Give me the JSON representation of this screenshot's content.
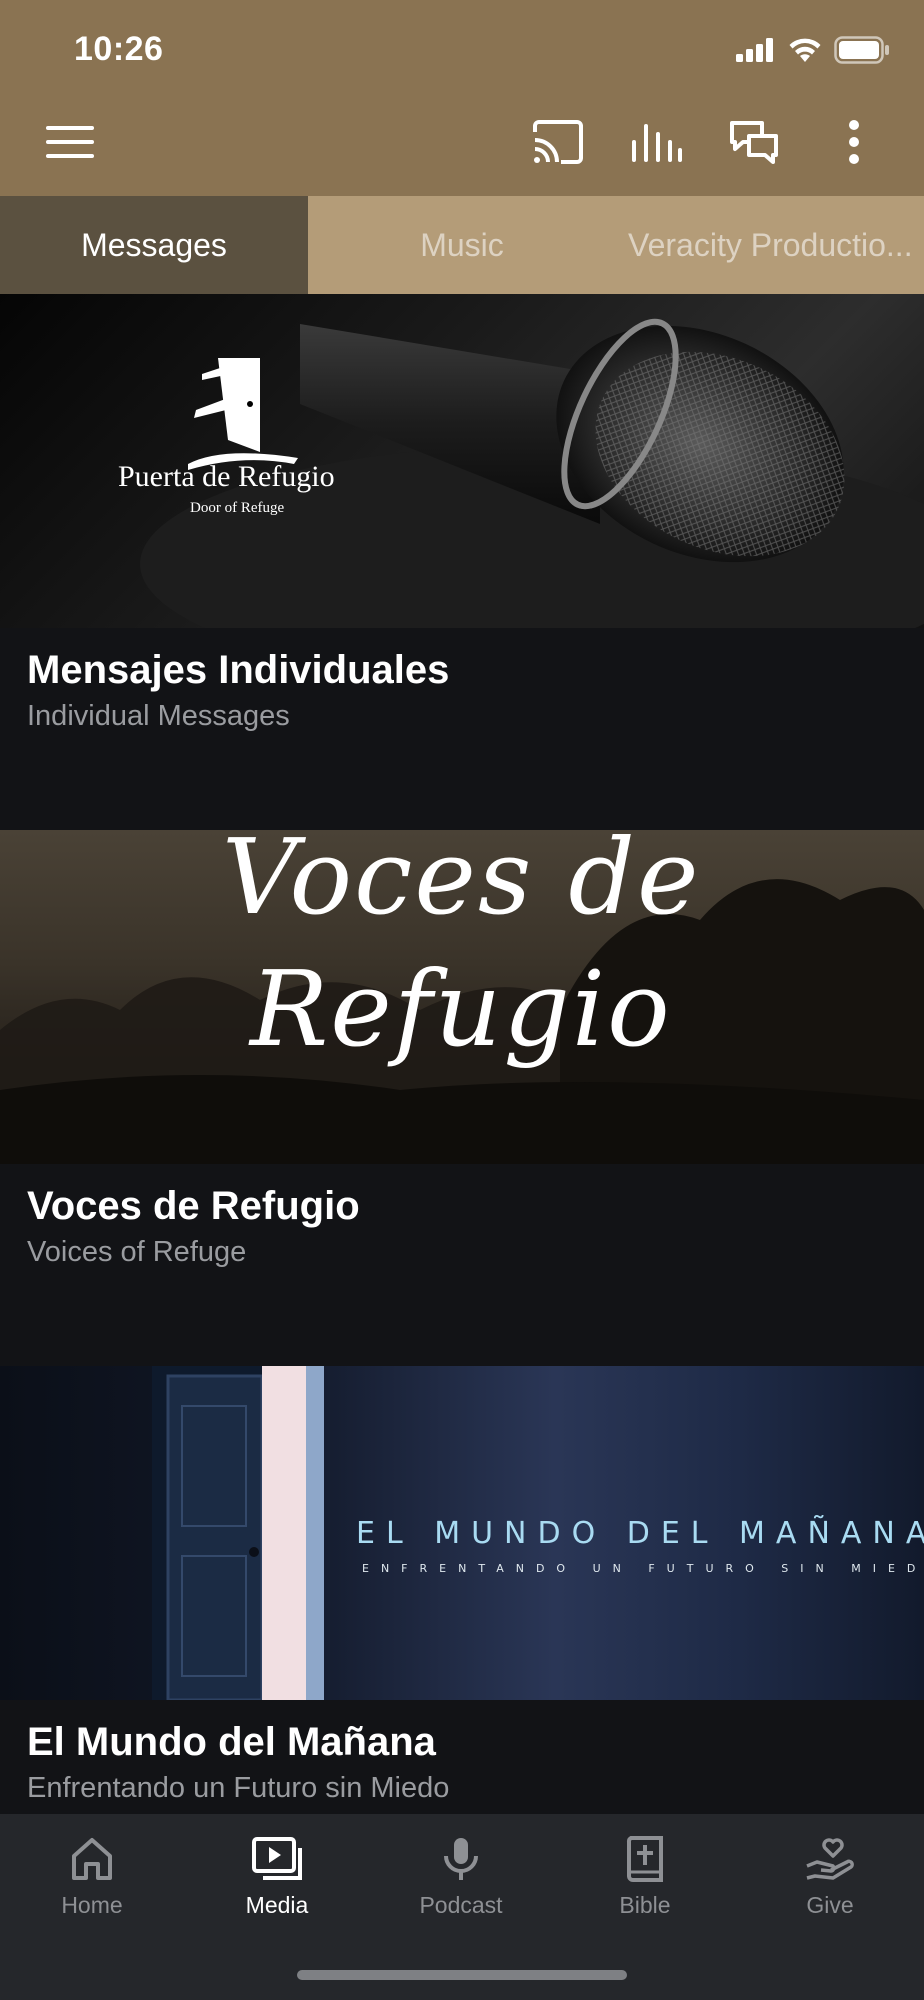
{
  "status_bar": {
    "time": "10:26"
  },
  "toolbar": {
    "icons": [
      "menu-icon",
      "cast-icon",
      "audio-bars-icon",
      "chat-icon",
      "more-vertical-icon"
    ]
  },
  "tabs": [
    {
      "label": "Messages",
      "active": true
    },
    {
      "label": "Music",
      "active": false
    },
    {
      "label": "Veracity Productio...",
      "active": false
    }
  ],
  "cards": [
    {
      "title": "Mensajes Individuales",
      "subtitle": "Individual Messages",
      "image_text": {
        "logo": "Puerta de Refugio",
        "logo_sub": "Door of Refuge"
      }
    },
    {
      "title": "Voces de Refugio",
      "subtitle": "Voices of Refuge",
      "image_text": {
        "line1": "Voces de",
        "line2": "Refugio"
      }
    },
    {
      "title": "El Mundo del Mañana",
      "subtitle": "Enfrentando un Futuro sin Miedo",
      "image_text": {
        "title": "EL MUNDO DEL MAÑANA",
        "subtitle": "ENFRENTANDO UN FUTURO SIN MIEDO"
      }
    }
  ],
  "bottom_nav": [
    {
      "label": "Home",
      "icon": "home-icon",
      "active": false
    },
    {
      "label": "Media",
      "icon": "media-icon",
      "active": true
    },
    {
      "label": "Podcast",
      "icon": "microphone-icon",
      "active": false
    },
    {
      "label": "Bible",
      "icon": "bible-icon",
      "active": false
    },
    {
      "label": "Give",
      "icon": "give-icon",
      "active": false
    }
  ],
  "colors": {
    "header": "#8a7352",
    "tab_bar": "#b49c78",
    "tab_active": "#5b5140",
    "background": "#121316",
    "nav_bar": "#25272b"
  }
}
